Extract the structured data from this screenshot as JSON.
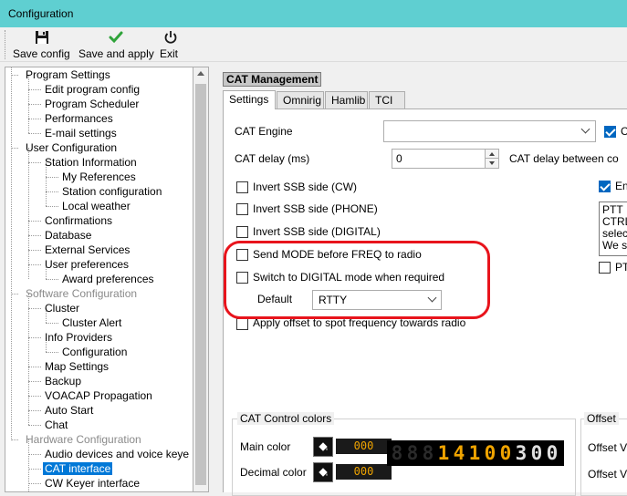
{
  "window": {
    "title": "Configuration"
  },
  "toolbar": {
    "save_config": "Save config",
    "save_and_apply": "Save and apply",
    "exit": "Exit"
  },
  "tree": [
    {
      "label": "Program Settings",
      "disabled": false,
      "selected": false
    },
    {
      "label": "Edit program config",
      "disabled": false,
      "selected": false
    },
    {
      "label": "Program Scheduler",
      "disabled": false,
      "selected": false
    },
    {
      "label": "Performances",
      "disabled": false,
      "selected": false
    },
    {
      "label": "E-mail settings",
      "disabled": false,
      "selected": false
    },
    {
      "label": "User Configuration",
      "disabled": false,
      "selected": false
    },
    {
      "label": "Station Information",
      "disabled": false,
      "selected": false
    },
    {
      "label": "My References",
      "disabled": false,
      "selected": false
    },
    {
      "label": "Station configuration",
      "disabled": false,
      "selected": false
    },
    {
      "label": "Local weather",
      "disabled": false,
      "selected": false
    },
    {
      "label": "Confirmations",
      "disabled": false,
      "selected": false
    },
    {
      "label": "Database",
      "disabled": false,
      "selected": false
    },
    {
      "label": "External Services",
      "disabled": false,
      "selected": false
    },
    {
      "label": "User preferences",
      "disabled": false,
      "selected": false
    },
    {
      "label": "Award preferences",
      "disabled": false,
      "selected": false
    },
    {
      "label": "Software Configuration",
      "disabled": true,
      "selected": false
    },
    {
      "label": "Cluster",
      "disabled": false,
      "selected": false
    },
    {
      "label": "Cluster Alert",
      "disabled": false,
      "selected": false
    },
    {
      "label": "Info Providers",
      "disabled": false,
      "selected": false
    },
    {
      "label": "Configuration",
      "disabled": false,
      "selected": false
    },
    {
      "label": "Map Settings",
      "disabled": false,
      "selected": false
    },
    {
      "label": "Backup",
      "disabled": false,
      "selected": false
    },
    {
      "label": "VOACAP Propagation",
      "disabled": false,
      "selected": false
    },
    {
      "label": "Auto Start",
      "disabled": false,
      "selected": false
    },
    {
      "label": "Chat",
      "disabled": false,
      "selected": false
    },
    {
      "label": "Hardware Configuration",
      "disabled": true,
      "selected": false
    },
    {
      "label": "Audio devices and voice keye",
      "disabled": false,
      "selected": false
    },
    {
      "label": "CAT interface",
      "disabled": false,
      "selected": true
    },
    {
      "label": "CW Keyer interface",
      "disabled": false,
      "selected": false
    }
  ],
  "panel": {
    "group_title": "CAT Management",
    "tabs": [
      "Settings",
      "Omnirig",
      "Hamlib",
      "TCI"
    ],
    "active_tab": "Settings",
    "cat_engine_label": "CAT Engine",
    "cat_engine_value": "",
    "cat_delay_label": "CAT delay (ms)",
    "cat_delay_value": "0",
    "cat_delay_between_label": "CAT delay between co",
    "right_checkbox_label_1": "C",
    "right_checkbox_label_2": "En",
    "right_checkbox_label_3": "PT",
    "ptt_memo": [
      "PTT",
      "CTRL",
      "selec",
      "We s"
    ],
    "options": [
      {
        "label": "Invert SSB side (CW)",
        "checked": false
      },
      {
        "label": "Invert SSB side (PHONE)",
        "checked": false
      },
      {
        "label": "Invert SSB side (DIGITAL)",
        "checked": false
      },
      {
        "label": "Send MODE before FREQ to radio",
        "checked": false
      },
      {
        "label": "Switch to DIGITAL mode when required",
        "checked": false
      }
    ],
    "default_label": "Default",
    "default_value": "RTTY",
    "apply_offset_label": "Apply offset to spot frequency towards radio",
    "apply_offset_checked": false,
    "colors_legend": "CAT Control colors",
    "main_color_label": "Main color",
    "main_color_value": "000",
    "decimal_color_label": "Decimal color",
    "decimal_color_value": "000",
    "lcd_digits": [
      "8",
      "8",
      "8",
      "1",
      "4",
      "1",
      "0",
      "0",
      "3",
      "0",
      "0"
    ],
    "lcd_digit_colors": [
      "#2a2a2a",
      "#2a2a2a",
      "#2a2a2a",
      "#f0a400",
      "#f0a400",
      "#f0a400",
      "#f0a400",
      "#f0a400",
      "#e0e0e0",
      "#e0e0e0",
      "#e0e0e0"
    ],
    "offset_legend": "Offset",
    "offset_label_1": "Offset V",
    "offset_label_2": "Offset V"
  },
  "colors": {
    "titlebar": "#5fcfd1",
    "selection": "#0078d7",
    "highlight_outline": "#e8141c",
    "checkbox_checked": "#0067c0",
    "lcd_amber": "#f0a400"
  }
}
